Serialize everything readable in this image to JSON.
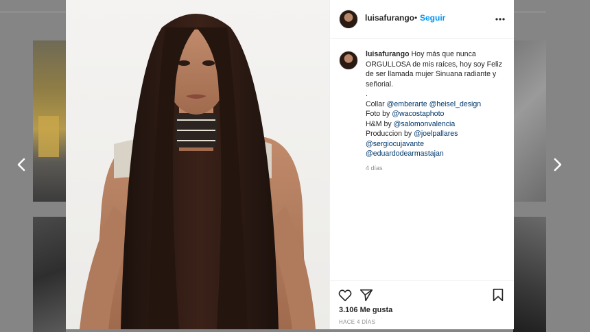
{
  "post": {
    "username": "luisafurango",
    "separator": "•",
    "follow_label": "Seguir",
    "caption": {
      "username": "luisafurango",
      "lines": [
        "Hoy más que nunca ORGULLOSA de mis raíces, hoy soy Feliz de ser llamada mujer Sinuana radiante y señorial.",
        "."
      ],
      "credits": [
        {
          "prefix": "Collar ",
          "tags": [
            "@emberarte",
            "@heisel_design"
          ]
        },
        {
          "prefix": "Foto by ",
          "tags": [
            "@wacostaphoto"
          ]
        },
        {
          "prefix": "H&M by ",
          "tags": [
            "@salomonvalencia"
          ]
        },
        {
          "prefix": "Produccion by ",
          "tags": [
            "@joelpallares"
          ]
        },
        {
          "prefix": "",
          "tags": [
            "@sergiocujavante"
          ]
        },
        {
          "prefix": "",
          "tags": [
            "@eduardodearmastajan"
          ]
        }
      ],
      "time": "4 días"
    },
    "likes": "3.106 Me gusta",
    "posted": "HACE 4 DÍAS"
  },
  "icons": {
    "more": "more-options-icon",
    "like": "heart-icon",
    "share": "share-icon",
    "save": "bookmark-icon",
    "prev": "chevron-left-icon",
    "next": "chevron-right-icon"
  },
  "colors": {
    "link": "#0095f6",
    "tag": "#00376b",
    "text": "#262626",
    "muted": "#8e8e8e"
  }
}
